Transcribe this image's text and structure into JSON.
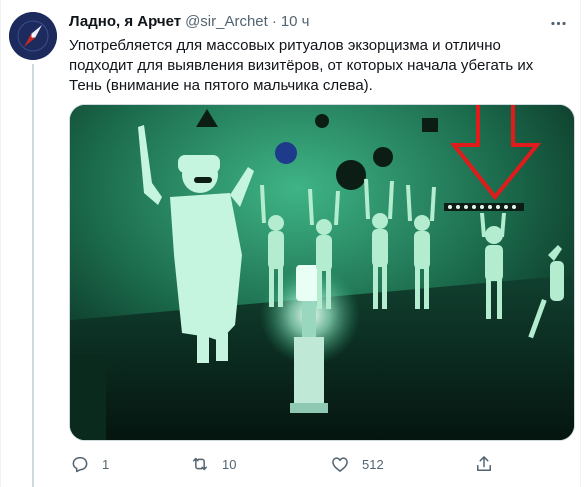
{
  "tweet": {
    "display_name": "Ладно, я Арчет",
    "handle": "@sir_Archet",
    "separator": "·",
    "time": "10 ч",
    "text": "Употребляется для массовых ритуалов экзорцизма и отлично подходит для выявления визитёров, от которых начала убегать их Тень (внимание на пятого мальчика слева).",
    "media_icon": "photo-with-red-arrow",
    "actions": {
      "reply_count": "1",
      "retweet_count": "10",
      "like_count": "512"
    }
  },
  "icons": {
    "avatar": "compass-needle-icon",
    "more": "more-dots-icon",
    "reply": "reply-icon",
    "retweet": "retweet-icon",
    "like": "heart-icon",
    "share": "share-icon"
  },
  "colors": {
    "text": "#0f1419",
    "muted": "#536471",
    "arrow": "#e01b1b",
    "scene": "#0c3a2a"
  }
}
